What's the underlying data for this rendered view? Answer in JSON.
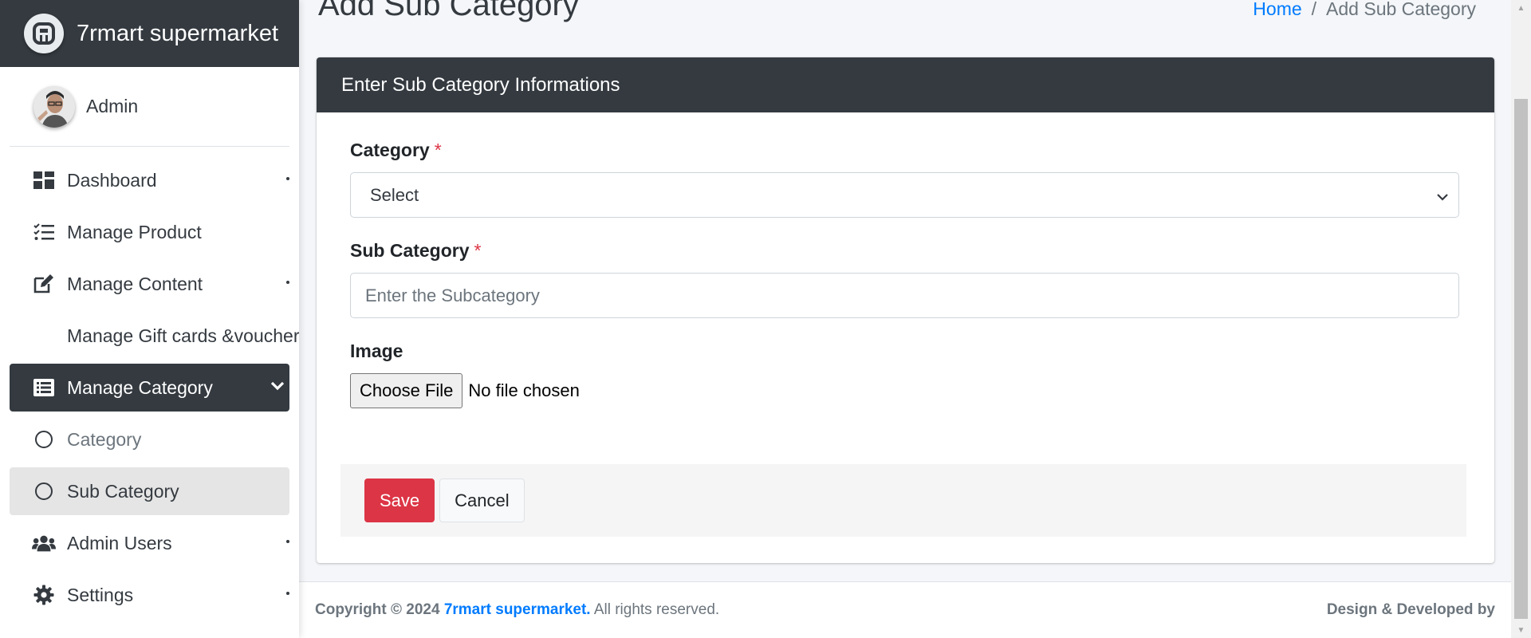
{
  "brand": {
    "title": "7rmart supermarket"
  },
  "user": {
    "name": "Admin"
  },
  "sidebar": {
    "items": [
      {
        "label": "Dashboard",
        "icon": "dashboard-icon"
      },
      {
        "label": "Manage Product",
        "icon": "list-check-icon"
      },
      {
        "label": "Manage Content",
        "icon": "edit-icon"
      },
      {
        "label": "Manage Gift cards &voucher"
      },
      {
        "label": "Manage Category",
        "icon": "list-alt-icon"
      },
      {
        "label": "Category",
        "icon": "circle-icon"
      },
      {
        "label": "Sub Category",
        "icon": "circle-icon"
      },
      {
        "label": "Admin Users",
        "icon": "users-icon"
      },
      {
        "label": "Settings",
        "icon": "gear-icon"
      }
    ]
  },
  "header": {
    "title": "Add Sub Category",
    "breadcrumb": {
      "home": "Home",
      "separator": "/",
      "current": "Add Sub Category"
    }
  },
  "form": {
    "card_title": "Enter Sub Category Informations",
    "category_label": "Category",
    "required_mark": "*",
    "category_selected": "Select",
    "subcategory_label": "Sub Category",
    "subcategory_placeholder": "Enter the Subcategory",
    "image_label": "Image",
    "file_button": "Choose File",
    "file_status": "No file chosen",
    "save_label": "Save",
    "cancel_label": "Cancel"
  },
  "footer": {
    "copyright": "Copyright © 2024",
    "brand": "7rmart supermarket.",
    "rights": "All rights reserved.",
    "credit": "Design & Developed by"
  },
  "colors": {
    "dark": "#343a40",
    "danger": "#dc3545",
    "link": "#007bff"
  }
}
